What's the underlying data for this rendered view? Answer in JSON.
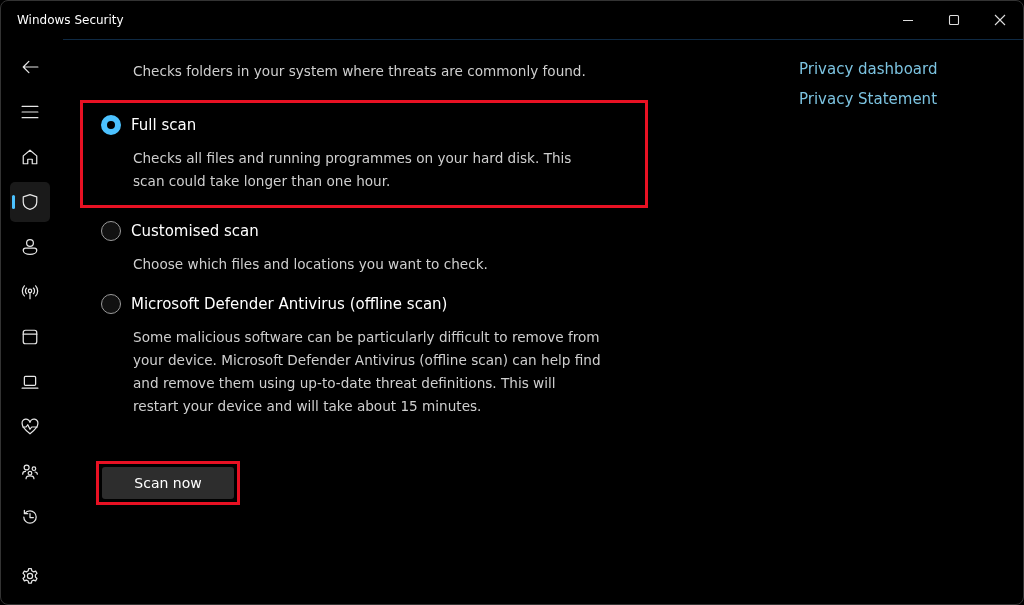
{
  "window": {
    "title": "Windows Security"
  },
  "sidebar": {
    "items": [
      {
        "kind": "back",
        "selected": false
      },
      {
        "kind": "menu",
        "selected": false
      },
      {
        "kind": "home",
        "selected": false
      },
      {
        "kind": "shield",
        "selected": true
      },
      {
        "kind": "person",
        "selected": false
      },
      {
        "kind": "antenna",
        "selected": false
      },
      {
        "kind": "window",
        "selected": false
      },
      {
        "kind": "laptop",
        "selected": false
      },
      {
        "kind": "heart",
        "selected": false
      },
      {
        "kind": "family",
        "selected": false
      },
      {
        "kind": "history",
        "selected": false
      },
      {
        "kind": "settings",
        "selected": false
      }
    ]
  },
  "scan_options": [
    {
      "description": "Checks folders in your system where threats are commonly found.",
      "highlighted": false
    },
    {
      "label": "Full scan",
      "selected": true,
      "highlighted": true,
      "description": "Checks all files and running programmes on your hard disk. This scan could take longer than one hour."
    },
    {
      "label": "Customised scan",
      "selected": false,
      "highlighted": false,
      "description": "Choose which files and locations you want to check."
    },
    {
      "label": "Microsoft Defender Antivirus (offline scan)",
      "selected": false,
      "highlighted": false,
      "description": "Some malicious software can be particularly difficult to remove from your device. Microsoft Defender Antivirus (offline scan) can help find and remove them using up-to-date threat definitions. This will restart your device and will take about 15 minutes."
    }
  ],
  "scan_button": {
    "label": "Scan now",
    "highlighted": true
  },
  "links": [
    "Privacy dashboard",
    "Privacy Statement"
  ]
}
